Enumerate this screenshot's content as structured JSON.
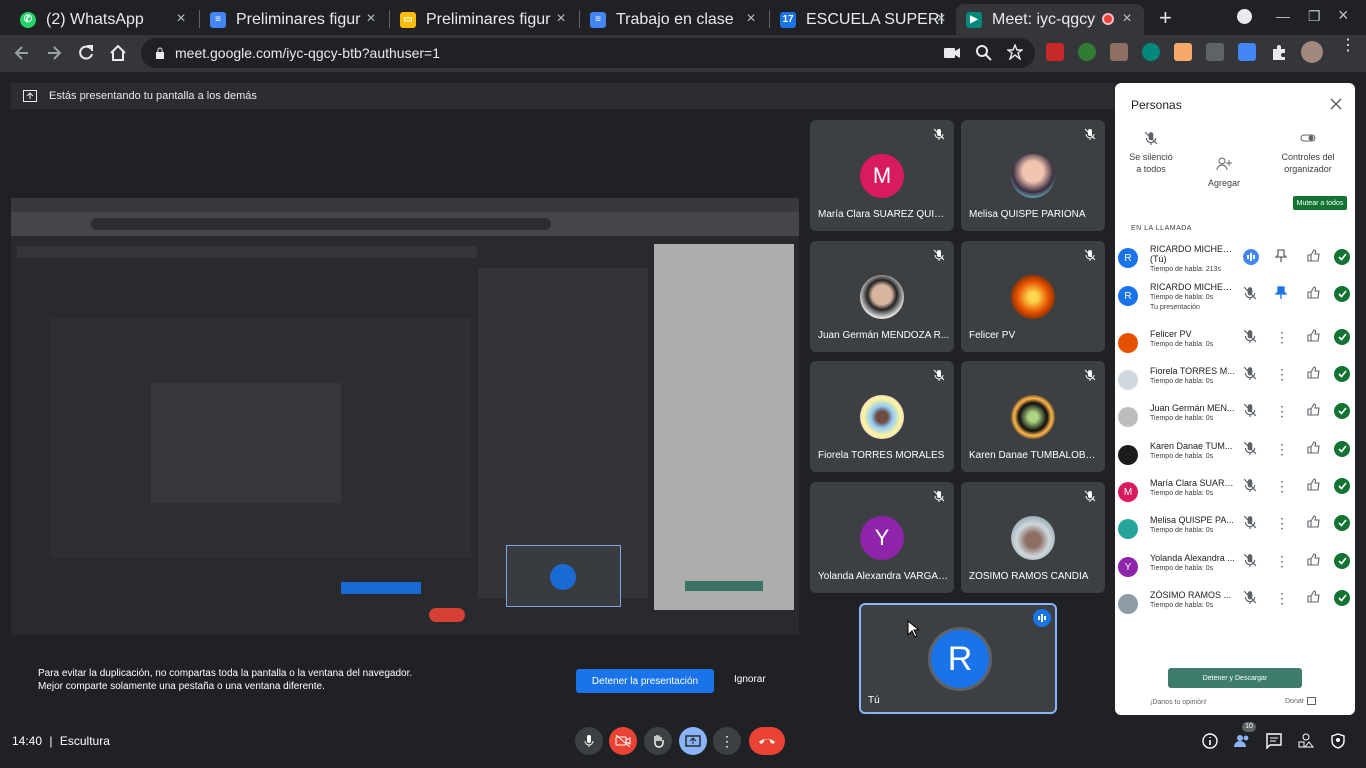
{
  "browser": {
    "tabs": [
      {
        "title": "(2) WhatsApp",
        "favicon": "whatsapp-icon",
        "color": "#25d366"
      },
      {
        "title": "Preliminares figur",
        "favicon": "docs-icon",
        "color": "#4285f4"
      },
      {
        "title": "Preliminares figur",
        "favicon": "slides-icon",
        "color": "#fbbc04"
      },
      {
        "title": "Trabajo en clase",
        "favicon": "docs-icon",
        "color": "#4285f4"
      },
      {
        "title": "ESCUELA SUPERI",
        "favicon": "calendar-icon",
        "color": "#1a73e8"
      },
      {
        "title": "Meet: iyc-qgcy",
        "favicon": "meet-icon",
        "color": "#00897b"
      }
    ],
    "url": "meet.google.com/iyc-qgcy-btb?authuser=1"
  },
  "meet": {
    "present_banner": "Estás presentando tu pantalla a los demás",
    "tiles": [
      {
        "name": "María Clara SUAREZ QUISPE",
        "initial": "M",
        "color": "#d81b60"
      },
      {
        "name": "Melisa QUISPE PARIONA",
        "initial": "",
        "color": "#7e57c2"
      },
      {
        "name": "Juan Germán MENDOZA R...",
        "initial": "",
        "color": "#e0e0e0"
      },
      {
        "name": "Felicer PV",
        "initial": "",
        "color": "#e65100"
      },
      {
        "name": "Fiorela TORRES MORALES",
        "initial": "",
        "color": "#cfd8dc"
      },
      {
        "name": "Karen Danae TUMBALOBO...",
        "initial": "",
        "color": "#1b1b1b"
      },
      {
        "name": "Yolanda Alexandra VARGAS...",
        "initial": "Y",
        "color": "#8e24aa"
      },
      {
        "name": "ZÓSIMO RAMOS CANDIA",
        "initial": "",
        "color": "#8d9ba6"
      }
    ],
    "self_tile": {
      "initial": "R",
      "label": "Tú"
    },
    "warning_line1": "Para evitar la duplicación, no compartas toda la pantalla o la ventana del navegador.",
    "warning_line2": "Mejor comparte solamente una pestaña o una ventana diferente.",
    "stop_button": "Detener la presentación",
    "ignore_button": "Ignorar",
    "time": "14:40",
    "separator": "|",
    "meeting_name": "Escultura",
    "people_count": "10"
  },
  "people_panel": {
    "title": "Personas",
    "actions": {
      "silence_line1": "Se silenció",
      "silence_line2": "a todos",
      "add": "Agregar",
      "host_line1": "Controles del",
      "host_line2": "organizador"
    },
    "mute_all": "Mutear a todos",
    "section": "EN LA LLAMADA",
    "participants": [
      {
        "name": "RICARDO MICHEL ...",
        "extra": "(Tú)",
        "time": "Tiempo de habla: 213s",
        "initial": "R",
        "color": "#1a73e8"
      },
      {
        "name": "RICARDO MICHEL ...",
        "time": "Tiempo de habla: 0s",
        "sub2": "Tu presentación",
        "initial": "R",
        "color": "#1a73e8"
      },
      {
        "name": "Felicer PV",
        "time": "Tiempo de habla: 0s",
        "initial": "",
        "color": "#e65100"
      },
      {
        "name": "Fiorela TORRES M...",
        "time": "Tiempo de habla: 0s",
        "initial": "",
        "color": "#cfd8dc"
      },
      {
        "name": "Juan Germán MEN...",
        "time": "Tiempo de habla: 0s",
        "initial": "",
        "color": "#bdbdbd"
      },
      {
        "name": "Karen Danae TUM...",
        "time": "Tiempo de habla: 0s",
        "initial": "",
        "color": "#1b1b1b"
      },
      {
        "name": "María Clara SUARE...",
        "time": "Tiempo de habla: 0s",
        "initial": "M",
        "color": "#d81b60"
      },
      {
        "name": "Melisa QUISPE PA...",
        "time": "Tiempo de habla: 0s",
        "initial": "",
        "color": "#26a69a"
      },
      {
        "name": "Yolanda Alexandra ...",
        "time": "Tiempo de habla: 0s",
        "initial": "Y",
        "color": "#8e24aa"
      },
      {
        "name": "ZÓSIMO RAMOS ...",
        "time": "Tiempo de habla: 0s",
        "initial": "",
        "color": "#8d9ba6"
      }
    ],
    "download_button": "Detener y Descargar",
    "feedback": "¡Danos tu opinión!",
    "donate": "Donar"
  }
}
